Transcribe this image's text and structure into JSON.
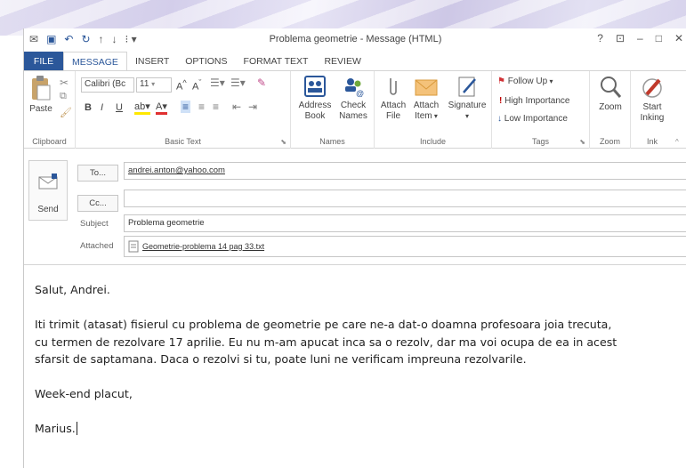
{
  "window": {
    "title": "Problema geometrie - Message (HTML)",
    "controls": [
      "?",
      "⊡",
      "–",
      "□",
      "✕"
    ]
  },
  "tabs": [
    "FILE",
    "MESSAGE",
    "INSERT",
    "OPTIONS",
    "FORMAT TEXT",
    "REVIEW"
  ],
  "ribbon": {
    "clipboard": {
      "paste": "Paste",
      "label": "Clipboard"
    },
    "basic_text": {
      "font": "Calibri (Bc",
      "size": "11",
      "bold": "B",
      "italic": "I",
      "underline": "U",
      "label": "Basic Text"
    },
    "names": {
      "address_book_1": "Address",
      "address_book_2": "Book",
      "check_names_1": "Check",
      "check_names_2": "Names",
      "label": "Names"
    },
    "include": {
      "attach_file_1": "Attach",
      "attach_file_2": "File",
      "attach_item_1": "Attach",
      "attach_item_2": "Item",
      "signature": "Signature",
      "label": "Include"
    },
    "tags": {
      "follow_up": "Follow Up",
      "high": "High Importance",
      "low": "Low Importance",
      "label": "Tags"
    },
    "zoom": {
      "button": "Zoom",
      "label": "Zoom"
    },
    "ink": {
      "button_1": "Start",
      "button_2": "Inking",
      "label": "Ink"
    }
  },
  "header": {
    "send": "Send",
    "to_button": "To...",
    "cc_button": "Cc...",
    "subject_label": "Subject",
    "attached_label": "Attached",
    "to_value": "andrei.anton@yahoo.com",
    "cc_value": "",
    "subject_value": "Problema geometrie",
    "attachment": "Geometrie-problema 14 pag 33.txt"
  },
  "message": {
    "greeting": "Salut, Andrei.",
    "line1": "Iti trimit (atasat) fisierul cu problema de geometrie pe care ne-a dat-o doamna profesoara joia trecuta,",
    "line2": "cu termen de rezolvare 17 aprilie. Eu nu m-am apucat inca sa o rezolv, dar ma voi ocupa de ea in acest",
    "line3": "sfarsit de saptamana. Daca o rezolvi si tu, poate luni ne verificam impreuna rezolvarile.",
    "closing": "Week-end placut,",
    "signature": "Marius."
  },
  "colors": {
    "accent": "#2b579a",
    "flag": "#d13438",
    "importance": "#c00000"
  }
}
